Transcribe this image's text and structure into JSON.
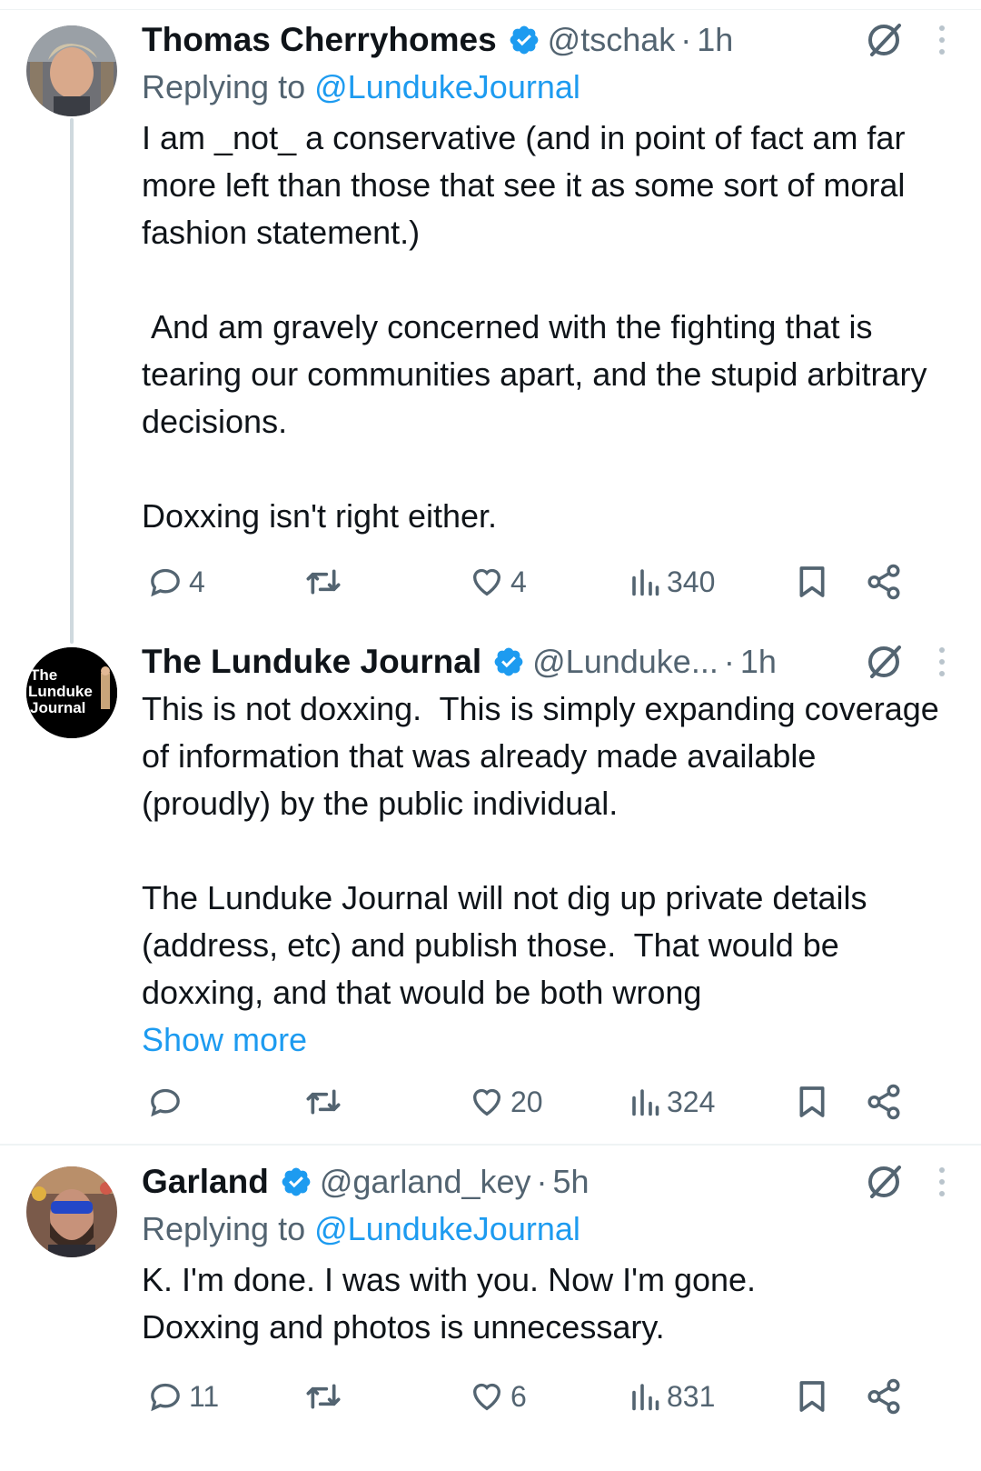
{
  "tweets": [
    {
      "author": "Thomas Cherryhomes",
      "handle": "@tschak",
      "time": "1h",
      "reply_prefix": "Replying to",
      "reply_to": "@LundukeJournal",
      "body": "I am _not_ a conservative (and in point of fact am far more left than those that see it as some sort of moral fashion statement.)\n\n And am gravely concerned with the fighting that is tearing our communities apart, and the stupid arbitrary decisions.\n\nDoxxing isn't right either.",
      "replies": "4",
      "reposts": "",
      "likes": "4",
      "views": "340"
    },
    {
      "author": "The Lunduke Journal",
      "handle": "@Lunduke...",
      "time": "1h",
      "avatar_text": "The\nLunduke\nJournal",
      "body": "This is not doxxing.  This is simply expanding coverage of information that was already made available (proudly) by the public individual.\n\nThe Lunduke Journal will not dig up private details (address, etc) and publish those.  That would be doxxing, and that would be both wrong",
      "show_more": "Show more",
      "replies": "",
      "reposts": "",
      "likes": "20",
      "views": "324"
    },
    {
      "author": "Garland",
      "handle": "@garland_key",
      "time": "5h",
      "reply_prefix": "Replying to",
      "reply_to": "@LundukeJournal",
      "body": "K. I'm done. I was with you. Now I'm gone.\nDoxxing and photos is unnecessary.",
      "replies": "11",
      "reposts": "",
      "likes": "6",
      "views": "831"
    }
  ],
  "icons": {
    "verified": "verified-badge-icon",
    "grok": "grok-icon",
    "more": "more-vertical-icon",
    "reply": "reply-icon",
    "repost": "repost-icon",
    "like": "heart-icon",
    "views": "views-icon",
    "bookmark": "bookmark-icon",
    "share": "share-icon"
  },
  "colors": {
    "accent": "#1d9bf0",
    "text": "#0f1419",
    "secondary": "#536471",
    "thread_line": "#cfd9de"
  }
}
